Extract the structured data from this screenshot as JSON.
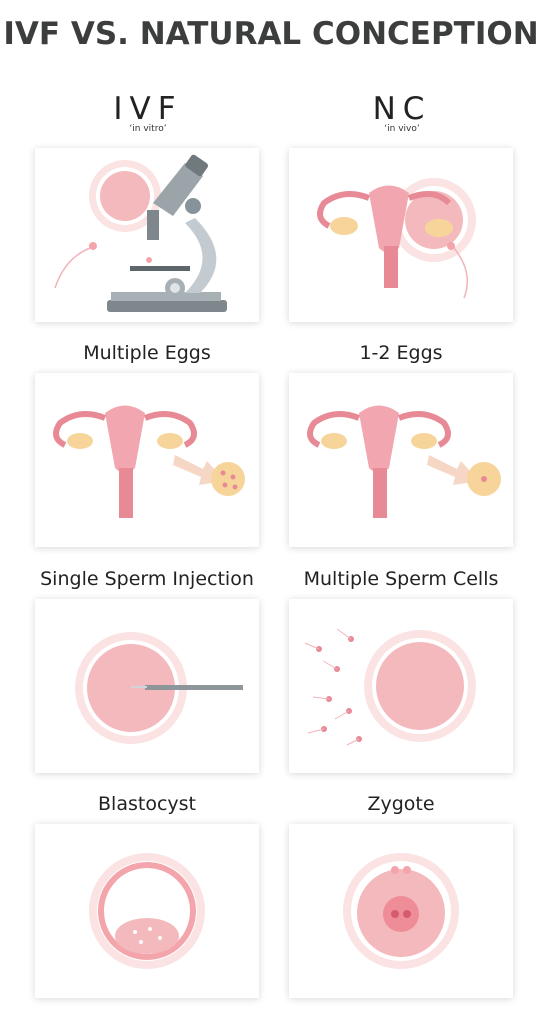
{
  "title": "IVF VS. NATURAL CONCEPTION",
  "columns": {
    "left": {
      "heading": "IVF",
      "subheading": "‘in vitro’"
    },
    "right": {
      "heading": "NC",
      "subheading": "‘in vivo’"
    }
  },
  "rows": [
    {
      "left_label": "Multiple Eggs",
      "right_label": "1-2 Eggs"
    },
    {
      "left_label": "Single Sperm Injection",
      "right_label": "Multiple Sperm Cells"
    },
    {
      "left_label": "Blastocyst",
      "right_label": "Zygote"
    }
  ],
  "colors": {
    "title": "#3c3e3e",
    "egg_pink": "#f4b9bd",
    "egg_core": "#f3a5ab",
    "uterus": "#e88a96",
    "ovary": "#f7d59a",
    "arrow": "#f6d7c6",
    "microscope": "#8a9499"
  }
}
